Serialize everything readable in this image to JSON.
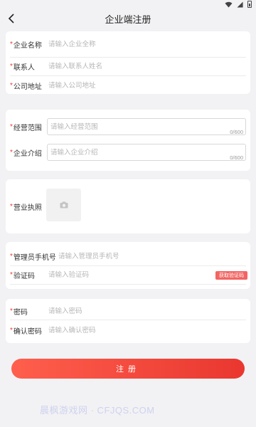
{
  "header": {
    "title": "企业端注册"
  },
  "required_mark": "*",
  "basic": {
    "company_name": {
      "label": "企业名称",
      "placeholder": "请输入企业全称"
    },
    "contact": {
      "label": "联系人",
      "placeholder": "请输入联系人姓名"
    },
    "address": {
      "label": "公司地址",
      "placeholder": "请输入公司地址"
    }
  },
  "business": {
    "scope": {
      "label": "经营范围",
      "placeholder": "请输入经营范围",
      "counter": "0/600"
    },
    "intro": {
      "label": "企业介绍",
      "placeholder": "请输入企业介绍",
      "counter": "0/600"
    }
  },
  "license": {
    "label": "营业执照"
  },
  "phone": {
    "admin_phone": {
      "label": "管理员手机号",
      "placeholder": "请输入管理员手机号"
    },
    "code": {
      "label": "验证码",
      "placeholder": "请输入验证码",
      "button": "获取验证码"
    }
  },
  "password": {
    "pwd": {
      "label": "密码",
      "placeholder": "请输入密码"
    },
    "confirm": {
      "label": "确认密码",
      "placeholder": "请输入确认密码"
    }
  },
  "submit_label": "注册",
  "watermark": "晨枫游戏网 · CFJQS.COM",
  "colors": {
    "accent": "#ef3b30",
    "background": "#f2f2f4"
  }
}
